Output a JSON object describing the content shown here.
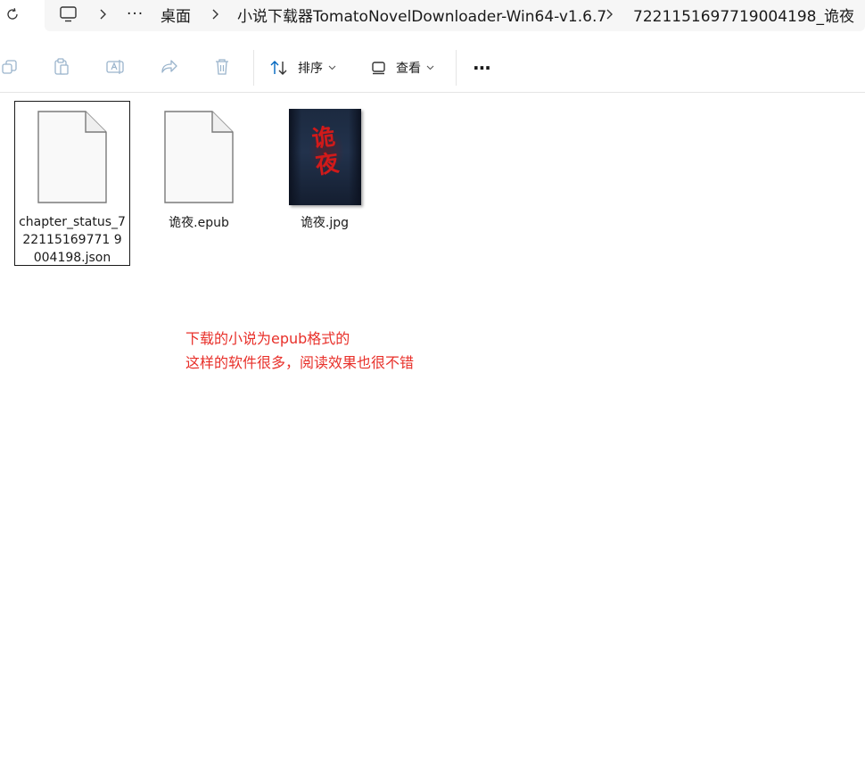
{
  "breadcrumb": {
    "items": [
      {
        "label": "桌面"
      },
      {
        "label": "小说下载器TomatoNovelDownloader-Win64-v1.6.7"
      },
      {
        "label": "7221151697719004198_诡夜"
      }
    ],
    "overflow": "···"
  },
  "toolbar": {
    "sort_label": "排序",
    "view_label": "查看",
    "more_label": "···"
  },
  "files": [
    {
      "name": "chapter_status_7221151697719004198.json",
      "display": "chapter_status_722115169771 9004198.json",
      "type": "file",
      "selected": true
    },
    {
      "name": "诡夜.epub",
      "type": "file",
      "selected": false
    },
    {
      "name": "诡夜.jpg",
      "type": "image",
      "selected": false,
      "cover_text": "诡夜"
    }
  ],
  "annotation": {
    "line1": "下载的小说为epub格式的",
    "line2": "这样的软件很多，阅读效果也很不错"
  },
  "colors": {
    "annotation": "#e8302a",
    "accent": "#0067c0"
  }
}
